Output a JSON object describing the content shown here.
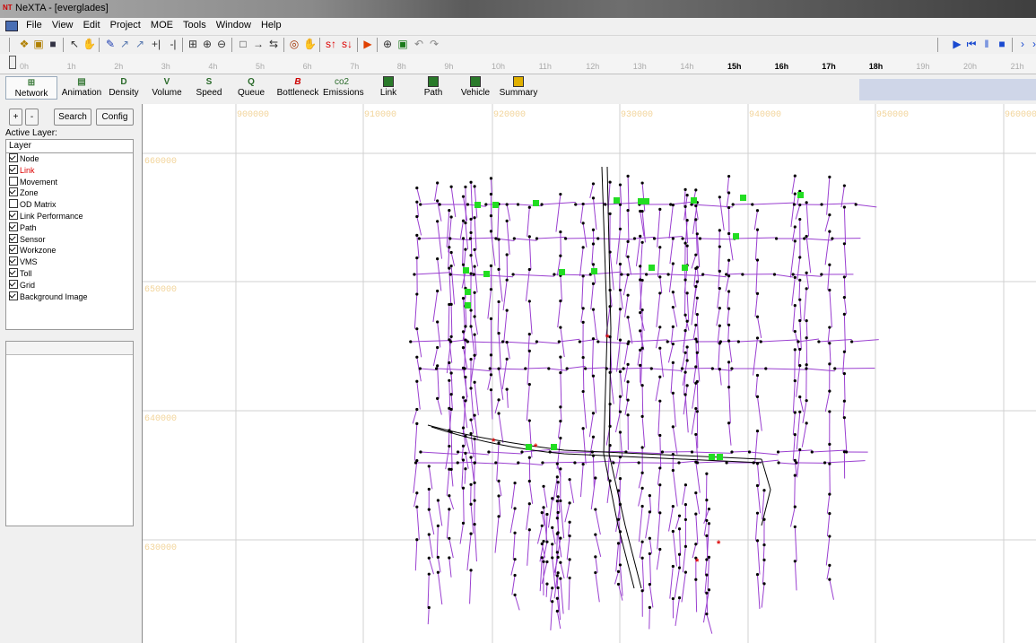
{
  "window": {
    "title": "NeXTA - [everglades]",
    "app_icon": "NT"
  },
  "menu": [
    "File",
    "View",
    "Edit",
    "Project",
    "MOE",
    "Tools",
    "Window",
    "Help"
  ],
  "timeline": {
    "hours": [
      "0h",
      "1h",
      "2h",
      "3h",
      "4h",
      "5h",
      "6h",
      "7h",
      "8h",
      "9h",
      "10h",
      "11h",
      "12h",
      "13h",
      "14h",
      "15h",
      "16h",
      "17h",
      "18h",
      "19h",
      "20h",
      "21h"
    ],
    "highlight": [
      "15h",
      "16h",
      "17h",
      "18h"
    ]
  },
  "layer_toolbar": [
    {
      "icon": "grid-icon",
      "glyph": "⊞",
      "label": "Network",
      "color": "#3a7a3a"
    },
    {
      "icon": "animation-icon",
      "glyph": "▤",
      "label": "Animation",
      "color": "#3a7a3a"
    },
    {
      "icon": "density-icon",
      "glyph": "D",
      "label": "Density",
      "color": "#2a6a2a"
    },
    {
      "icon": "volume-icon",
      "glyph": "V",
      "label": "Volume",
      "color": "#2a6a2a"
    },
    {
      "icon": "speed-icon",
      "glyph": "S",
      "label": "Speed",
      "color": "#2a6a2a"
    },
    {
      "icon": "queue-icon",
      "glyph": "Q",
      "label": "Queue",
      "color": "#2a6a2a"
    },
    {
      "icon": "bottleneck-icon",
      "glyph": "B",
      "label": "Bottleneck",
      "color": "#cc0000"
    },
    {
      "icon": "emissions-icon",
      "glyph": "co2",
      "label": "Emissions",
      "color": "#2a6a2a"
    },
    {
      "icon": "link-icon",
      "glyph": "",
      "label": "Link",
      "color": "#2a6a2a"
    },
    {
      "icon": "path-icon",
      "glyph": "",
      "label": "Path",
      "color": "#2a6a2a"
    },
    {
      "icon": "vehicle-icon",
      "glyph": "",
      "label": "Vehicle",
      "color": "#2a6a2a"
    },
    {
      "icon": "summary-icon",
      "glyph": "",
      "label": "Summary",
      "color": "#d0a000"
    }
  ],
  "left_panel": {
    "zoom_in": "+",
    "zoom_out": "-",
    "search": "Search",
    "config": "Config",
    "active_layer_label": "Active Layer:",
    "layer_header": "Layer",
    "layers": [
      {
        "label": "Node",
        "checked": true,
        "color": "#000000"
      },
      {
        "label": "Link",
        "checked": true,
        "color": "#dd0000"
      },
      {
        "label": "Movement",
        "checked": false,
        "color": "#000000"
      },
      {
        "label": "Zone",
        "checked": true,
        "color": "#000000"
      },
      {
        "label": "OD Matrix",
        "checked": false,
        "color": "#000000"
      },
      {
        "label": "Link Performance",
        "checked": true,
        "color": "#000000"
      },
      {
        "label": "Path",
        "checked": true,
        "color": "#000000"
      },
      {
        "label": "Sensor",
        "checked": true,
        "color": "#000000"
      },
      {
        "label": "Workzone",
        "checked": true,
        "color": "#000000"
      },
      {
        "label": "VMS",
        "checked": true,
        "color": "#000000"
      },
      {
        "label": "Toll",
        "checked": true,
        "color": "#000000"
      },
      {
        "label": "Grid",
        "checked": true,
        "color": "#000000"
      },
      {
        "label": "Background Image",
        "checked": true,
        "color": "#000000"
      }
    ]
  },
  "map": {
    "x_grid_labels": [
      "900000",
      "910000",
      "920000",
      "930000",
      "940000",
      "950000",
      "960000"
    ],
    "y_grid_labels": [
      "660000",
      "650000",
      "640000",
      "630000"
    ],
    "colors": {
      "grid": "#d0d0d0",
      "grid_label": "#f2d49a",
      "link": "#9a3fd0",
      "node": "#000000",
      "zone": "#22dd22",
      "highlight": "#dd0000"
    }
  },
  "toolbar_icons": [
    "open-icon",
    "folder-icon",
    "save-icon",
    "pointer-icon",
    "hand-icon",
    "draw-link-icon",
    "draw-link2-icon",
    "draw-link3-icon",
    "split-icon",
    "split2-icon",
    "fit-icon",
    "zoom-in-icon",
    "zoom-out-icon",
    "rect-select-icon",
    "arrow-right-icon",
    "swap-icon",
    "target-icon",
    "pan-icon",
    "speed-up-icon",
    "speed-down-icon",
    "play-red-icon",
    "zoom-area-icon",
    "export-icon",
    "undo-icon",
    "redo-icon"
  ],
  "playback_icons": [
    "play-icon",
    "rewind-icon",
    "pause-icon",
    "stop-icon",
    "next-icon",
    "fast-forward-icon"
  ]
}
